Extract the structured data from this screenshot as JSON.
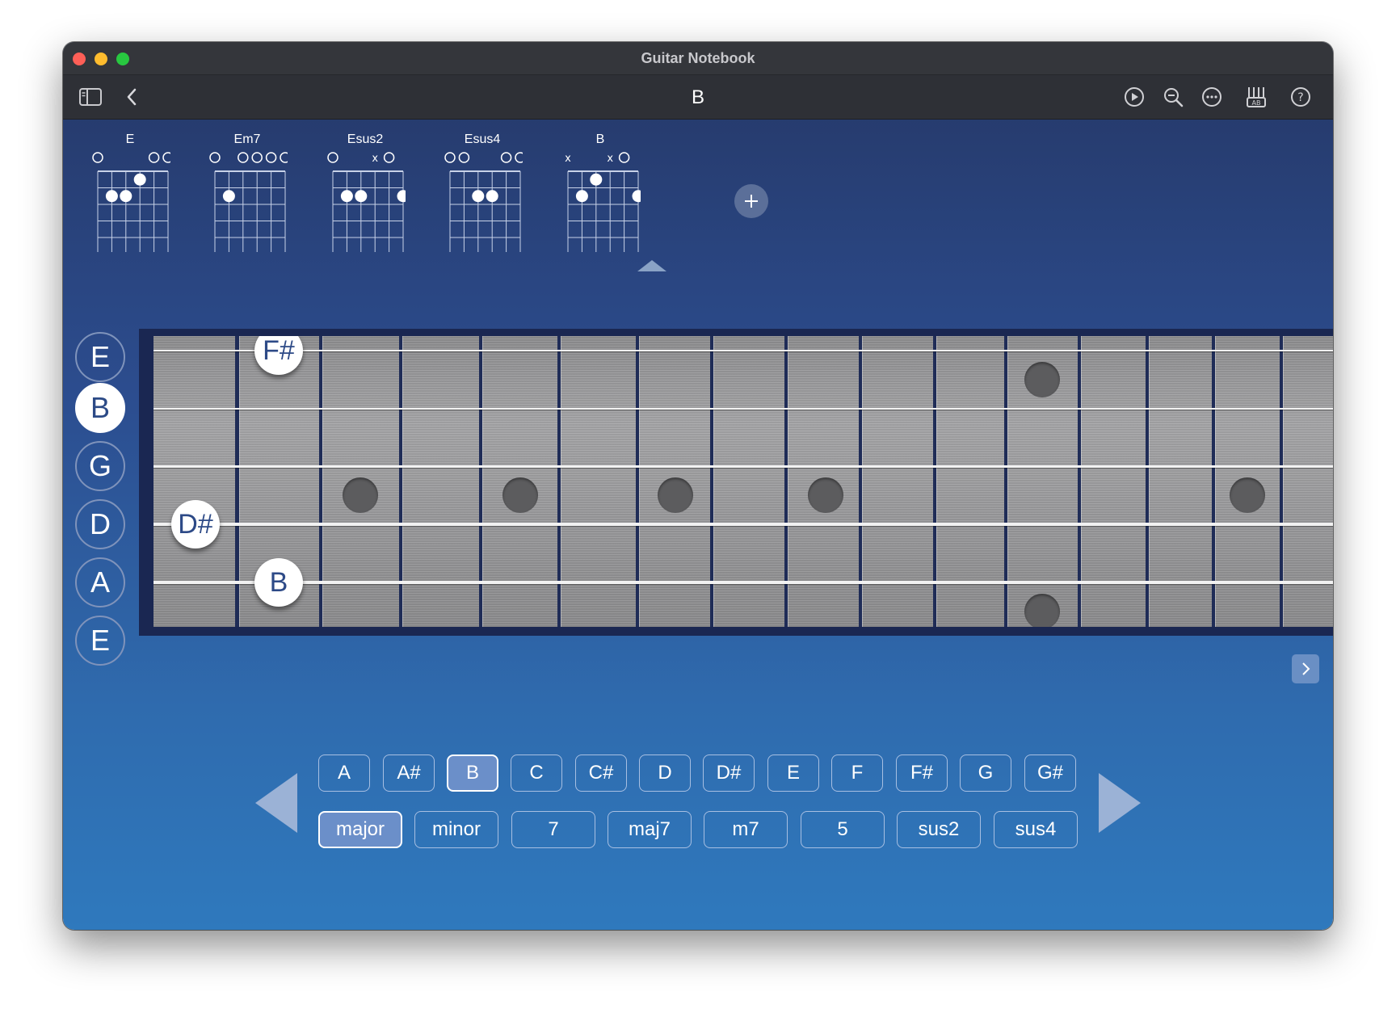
{
  "window": {
    "title": "Guitar Notebook"
  },
  "toolbar": {
    "title": "B",
    "left_icons": [
      "sidebar-icon",
      "back-chevron-icon"
    ],
    "right_icons": [
      "play-icon",
      "zoom-out-icon",
      "more-icon",
      "tuner-icon",
      "help-icon"
    ]
  },
  "chords": [
    {
      "name": "E",
      "markers": [
        "O",
        "",
        "",
        "",
        "O",
        "O"
      ],
      "dots": [
        [
          1,
          2
        ],
        [
          2,
          2
        ],
        [
          3,
          1
        ]
      ]
    },
    {
      "name": "Em7",
      "markers": [
        "O",
        "",
        "O",
        "O",
        "O",
        "O"
      ],
      "dots": [
        [
          1,
          2
        ]
      ]
    },
    {
      "name": "Esus2",
      "markers": [
        "O",
        "",
        "",
        "x",
        "O",
        ""
      ],
      "dots": [
        [
          1,
          2
        ],
        [
          2,
          2
        ],
        [
          5,
          2
        ]
      ]
    },
    {
      "name": "Esus4",
      "markers": [
        "O",
        "O",
        "",
        "",
        "O",
        "O"
      ],
      "dots": [
        [
          2,
          2
        ],
        [
          3,
          2
        ]
      ]
    },
    {
      "name": "B",
      "markers": [
        "x",
        "",
        "",
        "x",
        "O",
        ""
      ],
      "dots": [
        [
          1,
          2
        ],
        [
          2,
          1
        ],
        [
          5,
          2
        ]
      ]
    }
  ],
  "selected_chord_index": 4,
  "strings": [
    "E",
    "B",
    "G",
    "D",
    "A",
    "E"
  ],
  "active_string_index": 1,
  "fretboard_notes": [
    {
      "label": "F#",
      "string": 0,
      "fret": 2
    },
    {
      "label": "D#",
      "string": 3,
      "fret": 1
    },
    {
      "label": "B",
      "string": 4,
      "fret": 2
    }
  ],
  "keys": [
    "A",
    "A#",
    "B",
    "C",
    "C#",
    "D",
    "D#",
    "E",
    "F",
    "F#",
    "G",
    "G#"
  ],
  "selected_key": "B",
  "chord_types": [
    "major",
    "minor",
    "7",
    "maj7",
    "m7",
    "5",
    "sus2",
    "sus4"
  ],
  "selected_type": "major",
  "colors": {
    "background_top": "#253766",
    "background_bottom": "#2f79bd",
    "selected_button": "#6b8fc9",
    "note_text": "#2d4a87"
  }
}
